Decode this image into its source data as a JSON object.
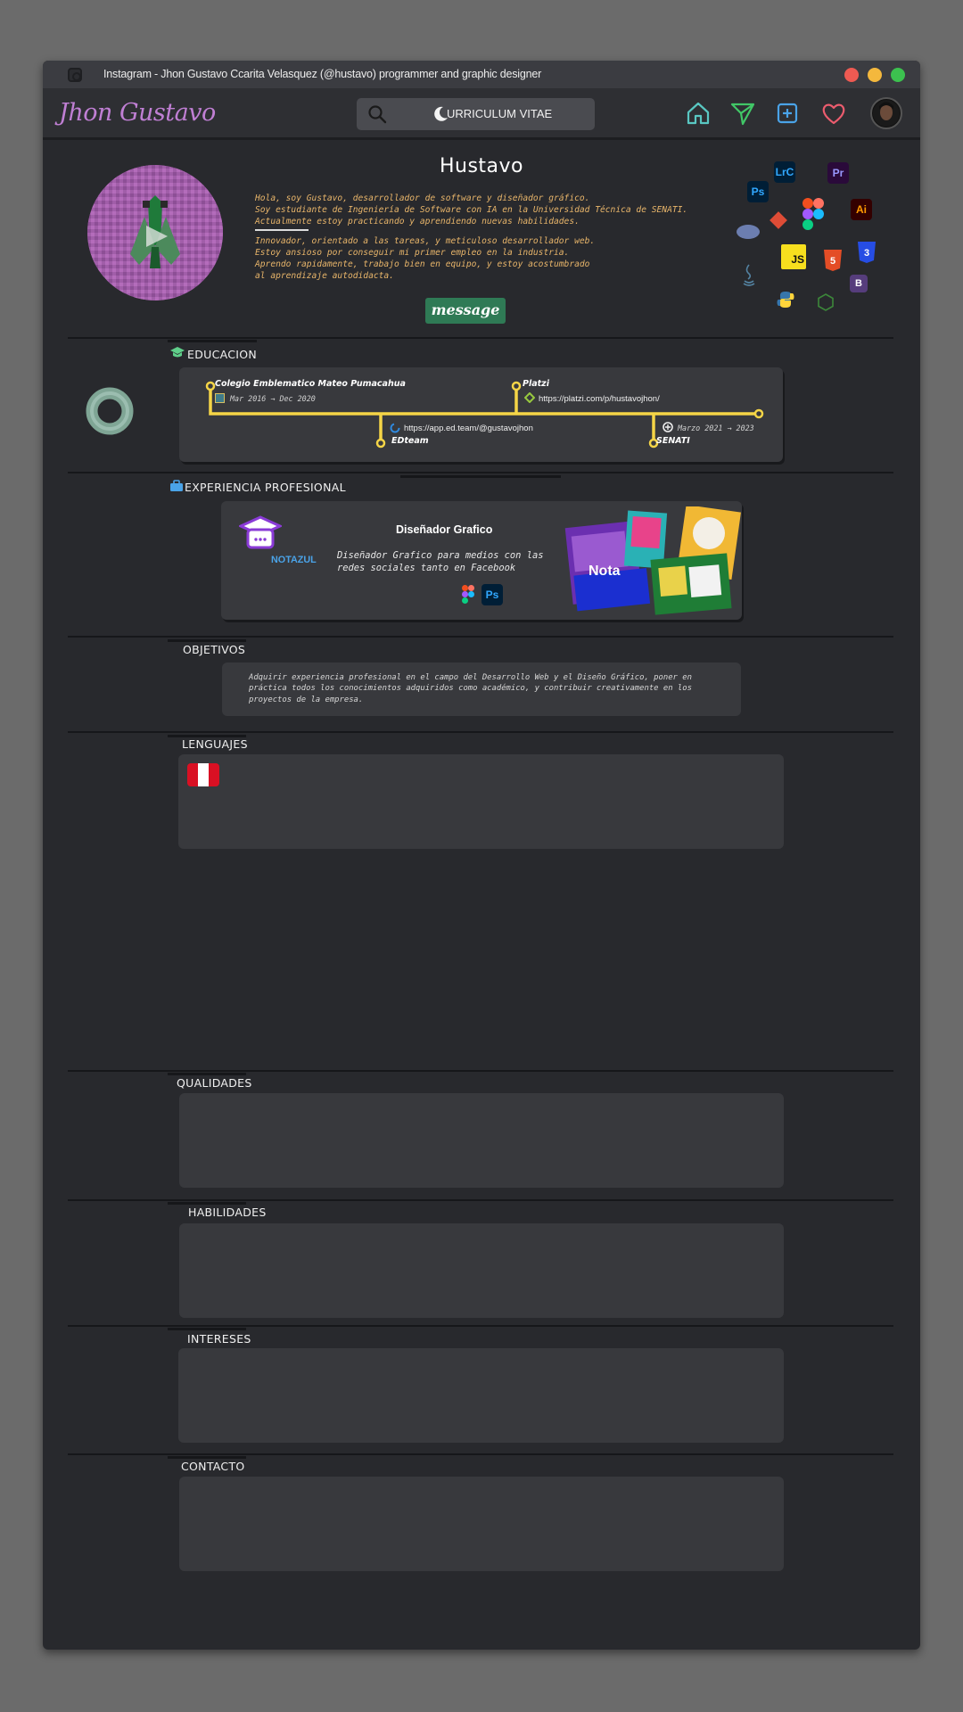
{
  "window": {
    "title": "Instagram - Jhon Gustavo Ccarita Velasquez (@hustavo)   programmer and graphic designer",
    "traffic_lights": [
      "#ee5a52",
      "#f4b83d",
      "#3cc14f"
    ]
  },
  "navbar": {
    "brand": "Jhon Gustavo",
    "search_text": "URRICULUM VITAE",
    "icons": [
      "home-icon",
      "send-icon",
      "add-post-icon",
      "heart-icon",
      "avatar"
    ]
  },
  "profile": {
    "name": "Hustavo",
    "bio_1": "Hola, soy Gustavo, desarrollador de software y diseñador gráfico.\nSoy estudiante de Ingeniería de Software con IA en la Universidad Técnica de SENATI.\nActualmente estoy practicando y aprendiendo nuevas habilidades.",
    "bio_2": "Innovador, orientado a las tareas, y meticuloso desarrollador web.\nEstoy ansioso por conseguir mi primer empleo en la industria.\nAprendo rapidamente, trabajo bien en equipo, y estoy acostumbrado\nal aprendizaje autodidacta.",
    "message_button": "message",
    "tech_icons": [
      "LrC",
      "Pr",
      "Ps",
      "Ai",
      "JS",
      "B"
    ]
  },
  "education": {
    "title": "EDUCACION",
    "items": [
      {
        "name": "Colegio Emblematico Mateo Pumacahua",
        "date": "Mar 2016 → Dec 2020"
      },
      {
        "name": "Platzi",
        "url": "https://platzi.com/p/hustavojhon/"
      },
      {
        "name": "EDteam",
        "url": "https://app.ed.team/@gustavojhon"
      },
      {
        "name": "SENATI",
        "date": "Marzo 2021 → 2023"
      }
    ]
  },
  "experience": {
    "title": "EXPERIENCIA PROFESIONAL",
    "company_logo_text": "NOTAZUL",
    "job_title": "Diseñador Grafico",
    "job_desc": "Diseñador Grafico para medios con las redes sociales tanto en Facebook",
    "tools": [
      "figma-icon",
      "Ps"
    ],
    "showcase_text": "Nota"
  },
  "objectives": {
    "title": "OBJETIVOS",
    "text": "Adquirir experiencia profesional en el campo del Desarrollo Web y el Diseño Gráfico, poner en práctica todos los conocimientos adquiridos como académico, y contribuir creativamente en los proyectos de la empresa."
  },
  "languages": {
    "title": "LENGUAJES",
    "flags": [
      "peru-flag"
    ]
  },
  "qualities": {
    "title": "QUALIDADES"
  },
  "skills": {
    "title": "HABILIDADES"
  },
  "interests": {
    "title": "INTERESES"
  },
  "contact": {
    "title": "CONTACTO"
  },
  "colors": {
    "background": "#28292d",
    "card": "#38393d",
    "brand": "#c07fd4",
    "timeline": "#f5d547",
    "message_button": "#2f7a55",
    "bio_text": "#e8b56a"
  }
}
